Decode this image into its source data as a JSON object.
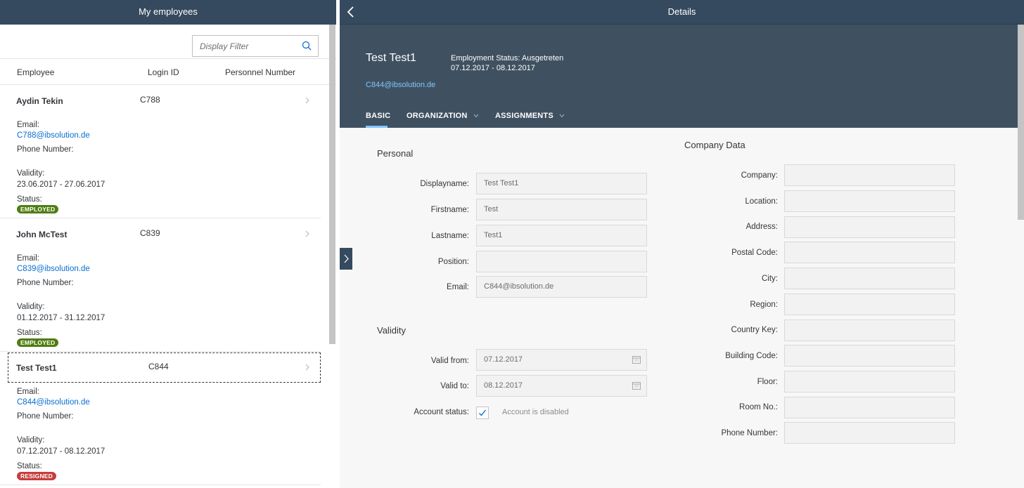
{
  "master": {
    "title": "My employees",
    "filter_placeholder": "Display Filter",
    "columns": {
      "employee": "Employee",
      "login": "Login ID",
      "personnel": "Personnel Number"
    },
    "employees": [
      {
        "name": "Aydin Tekin",
        "login": "C788",
        "email_label": "Email:",
        "email": "C788@ibsolution.de",
        "phone_label": "Phone Number:",
        "validity_label": "Validity:",
        "validity": "23.06.2017 - 27.06.2017",
        "status_label": "Status:",
        "status": "EMPLOYED"
      },
      {
        "name": "John McTest",
        "login": "C839",
        "email_label": "Email:",
        "email": "C839@ibsolution.de",
        "phone_label": "Phone Number:",
        "validity_label": "Validity:",
        "validity": "01.12.2017 - 31.12.2017",
        "status_label": "Status:",
        "status": "EMPLOYED"
      },
      {
        "name": "Test Test1",
        "login": "C844",
        "email_label": "Email:",
        "email": "C844@ibsolution.de",
        "phone_label": "Phone Number:",
        "validity_label": "Validity:",
        "validity": "07.12.2017 - 08.12.2017",
        "status_label": "Status:",
        "status": "RESIGNED"
      }
    ]
  },
  "detail": {
    "title": "Details",
    "object": {
      "name": "Test Test1",
      "status_line": "Employment Status: Ausgetreten",
      "date_range": "07.12.2017 - 08.12.2017",
      "email": "C844@ibsolution.de"
    },
    "tabs": [
      {
        "label": "BASIC"
      },
      {
        "label": "ORGANIZATION"
      },
      {
        "label": "ASSIGNMENTS"
      }
    ],
    "personal": {
      "title": "Personal",
      "displayname_label": "Displayname:",
      "displayname": "Test Test1",
      "firstname_label": "Firstname:",
      "firstname": "Test",
      "lastname_label": "Lastname:",
      "lastname": "Test1",
      "position_label": "Position:",
      "position": "",
      "email_label": "Email:",
      "email": "C844@ibsolution.de"
    },
    "validity": {
      "title": "Validity",
      "valid_from_label": "Valid from:",
      "valid_from": "07.12.2017",
      "valid_to_label": "Valid to:",
      "valid_to": "08.12.2017",
      "account_status_label": "Account status:",
      "account_status_text": "Account is disabled"
    },
    "company": {
      "title": "Company Data",
      "fields": [
        {
          "label": "Company:",
          "value": ""
        },
        {
          "label": "Location:",
          "value": ""
        },
        {
          "label": "Address:",
          "value": ""
        },
        {
          "label": "Postal Code:",
          "value": ""
        },
        {
          "label": "City:",
          "value": ""
        },
        {
          "label": "Region:",
          "value": ""
        },
        {
          "label": "Country Key:",
          "value": ""
        },
        {
          "label": "Building Code:",
          "value": ""
        },
        {
          "label": "Floor:",
          "value": ""
        },
        {
          "label": "Room No.:",
          "value": ""
        },
        {
          "label": "Phone Number:",
          "value": ""
        }
      ]
    }
  },
  "colors": {
    "shell": "#354a5f",
    "object_header": "#3f5161",
    "link": "#0a6ed1",
    "employed": "#4f7d12",
    "resigned": "#c53d3d"
  }
}
